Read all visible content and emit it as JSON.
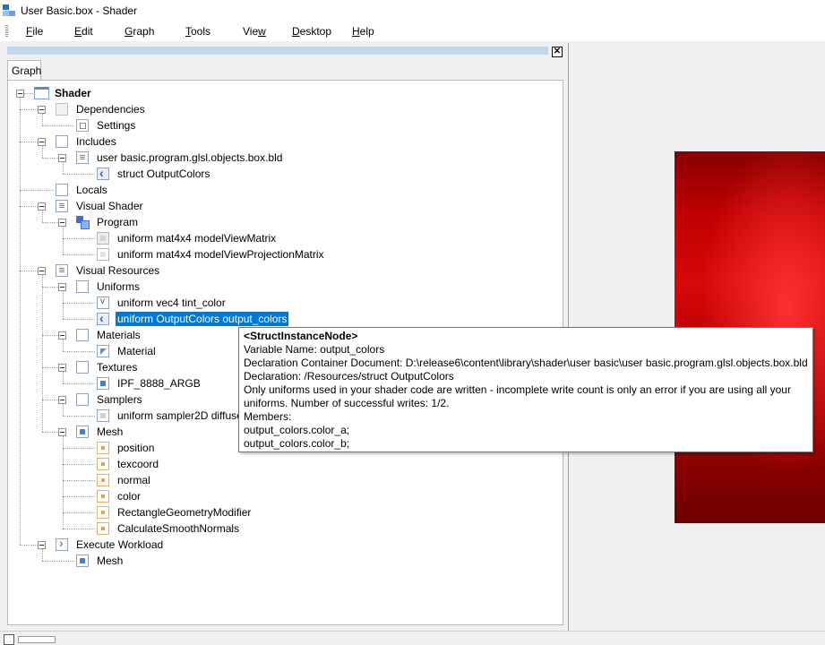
{
  "window": {
    "title": "User Basic.box - Shader"
  },
  "menu": [
    {
      "label": "File",
      "mnemonic": "F",
      "rest": "ile"
    },
    {
      "label": "Edit",
      "mnemonic": "E",
      "rest": "dit"
    },
    {
      "label": "Graph",
      "mnemonic": "G",
      "rest": "raph"
    },
    {
      "label": "Tools",
      "mnemonic": "T",
      "rest": "ools"
    },
    {
      "label": "View",
      "pre": "Vie",
      "mnemonic": "w"
    },
    {
      "label": "Desktop",
      "mnemonic": "D",
      "rest": "esktop"
    },
    {
      "label": "Help",
      "mnemonic": "H",
      "rest": "elp"
    }
  ],
  "panel": {
    "tab": "Graph",
    "close": "✕"
  },
  "tree": [
    {
      "label": "Shader",
      "icon": "shader-icon"
    },
    {
      "label": "Dependencies",
      "icon": "dependencies-icon"
    },
    {
      "label": "Settings",
      "icon": "settings-icon"
    },
    {
      "label": "Includes",
      "icon": "folder-icon"
    },
    {
      "label": "user basic.program.glsl.objects.box.bld",
      "icon": "document-icon"
    },
    {
      "label": "struct OutputColors",
      "icon": "struct-icon"
    },
    {
      "label": "Locals",
      "icon": "folder-icon"
    },
    {
      "label": "Visual Shader",
      "icon": "document-icon"
    },
    {
      "label": "Program",
      "icon": "program-icon"
    },
    {
      "label": "uniform mat4x4 modelViewMatrix",
      "icon": "matrix-icon"
    },
    {
      "label": "uniform mat4x4 modelViewProjectionMatrix",
      "icon": "matrix-icon"
    },
    {
      "label": "Visual Resources",
      "icon": "document-icon"
    },
    {
      "label": "Uniforms",
      "icon": "folder-icon"
    },
    {
      "label": "uniform vec4 tint_color",
      "icon": "vector-icon"
    },
    {
      "label": "uniform OutputColors output_colors",
      "icon": "struct-icon"
    },
    {
      "label": "Materials",
      "icon": "folder-icon"
    },
    {
      "label": "Material",
      "icon": "material-icon"
    },
    {
      "label": "Textures",
      "icon": "folder-icon"
    },
    {
      "label": "IPF_8888_ARGB",
      "icon": "texture-icon"
    },
    {
      "label": "Samplers",
      "icon": "folder-icon"
    },
    {
      "label": "uniform sampler2D diffuse",
      "icon": "sampler-icon"
    },
    {
      "label": "Mesh",
      "icon": "mesh-icon"
    },
    {
      "label": "position",
      "icon": "attribute-icon"
    },
    {
      "label": "texcoord",
      "icon": "attribute-icon"
    },
    {
      "label": "normal",
      "icon": "attribute-icon"
    },
    {
      "label": "color",
      "icon": "attribute-icon"
    },
    {
      "label": "RectangleGeometryModifier",
      "icon": "modifier-icon"
    },
    {
      "label": "CalculateSmoothNormals",
      "icon": "modifier-icon"
    },
    {
      "label": "Execute Workload",
      "icon": "execute-icon"
    },
    {
      "label": "Mesh",
      "icon": "mesh-icon"
    }
  ],
  "tooltip": {
    "title": "<StructInstanceNode>",
    "lines": [
      "Variable Name: output_colors",
      "Declaration Container Document: D:\\release6\\content\\library\\shader\\user basic\\user basic.program.glsl.objects.box.bld",
      "Declaration: /Resources/struct OutputColors",
      "Only uniforms used in your shader code are written - incomplete write count is only an error if you are using all your",
      "uniforms. Number of successful writes: 1/2.",
      "Members:",
      "output_colors.color_a;",
      "output_colors.color_b;"
    ]
  },
  "colors": {
    "selection": "#0078d7",
    "preview": "#c10000"
  }
}
